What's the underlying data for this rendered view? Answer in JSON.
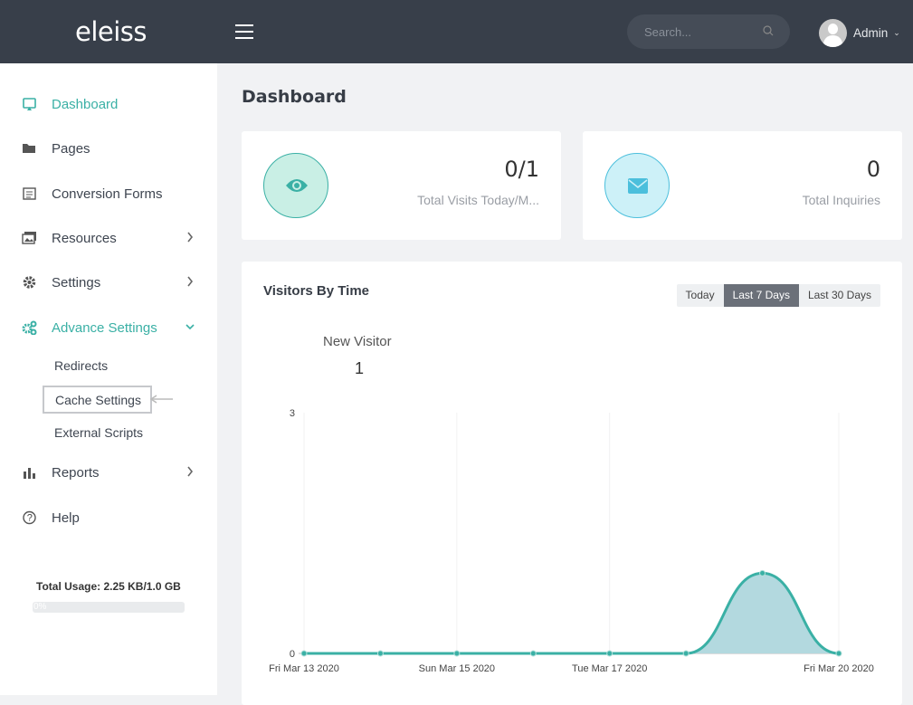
{
  "header": {
    "logo": "eleiss",
    "search_placeholder": "Search...",
    "user": "Admin"
  },
  "sidebar": {
    "items": [
      {
        "label": "Dashboard",
        "icon": "monitor-icon",
        "active": true
      },
      {
        "label": "Pages",
        "icon": "folder-icon"
      },
      {
        "label": "Conversion Forms",
        "icon": "form-icon"
      },
      {
        "label": "Resources",
        "icon": "images-icon",
        "chevron": "right"
      },
      {
        "label": "Settings",
        "icon": "gear-icon",
        "chevron": "right"
      },
      {
        "label": "Advance Settings",
        "icon": "gears-icon",
        "chevron": "down",
        "active": true
      },
      {
        "label": "Reports",
        "icon": "bar-chart-icon",
        "chevron": "right"
      },
      {
        "label": "Help",
        "icon": "question-circle-icon"
      }
    ],
    "subitems": [
      "Redirects",
      "Cache Settings",
      "External Scripts"
    ],
    "usage_label": "Total Usage: 2.25 KB/1.0 GB",
    "usage_percent_label": "0%",
    "usage_percent": 0
  },
  "main": {
    "title": "Dashboard",
    "stats": [
      {
        "value": "0/1",
        "label": "Total Visits Today/M...",
        "icon": "eye-icon",
        "color": "#3ab0a5"
      },
      {
        "value": "0",
        "label": "Total Inquiries",
        "icon": "envelope-icon",
        "color": "#4bbfdc"
      }
    ],
    "chart_card": {
      "title": "Visitors By Time",
      "ranges": [
        "Today",
        "Last 7 Days",
        "Last 30 Days"
      ],
      "selected": "Last 7 Days",
      "metric_label": "New Visitor",
      "metric_value": "1"
    }
  },
  "chart_data": {
    "type": "area",
    "x": [
      "Fri Mar 13 2020",
      "Sat Mar 14 2020",
      "Sun Mar 15 2020",
      "Mon Mar 16 2020",
      "Tue Mar 17 2020",
      "Wed Mar 18 2020",
      "Thu Mar 19 2020",
      "Fri Mar 20 2020"
    ],
    "x_tick_labels": [
      "Fri Mar 13 2020",
      "Sun Mar 15 2020",
      "Tue Mar 17 2020",
      "Fri Mar 20 2020"
    ],
    "values": [
      0,
      0,
      0,
      0,
      0,
      0,
      1,
      0
    ],
    "ylim": [
      0,
      3
    ],
    "y_tick_labels": [
      "0",
      "3"
    ],
    "line_color": "#3ab0a5",
    "fill_color": "#b3d9df",
    "grid": "vertical"
  }
}
